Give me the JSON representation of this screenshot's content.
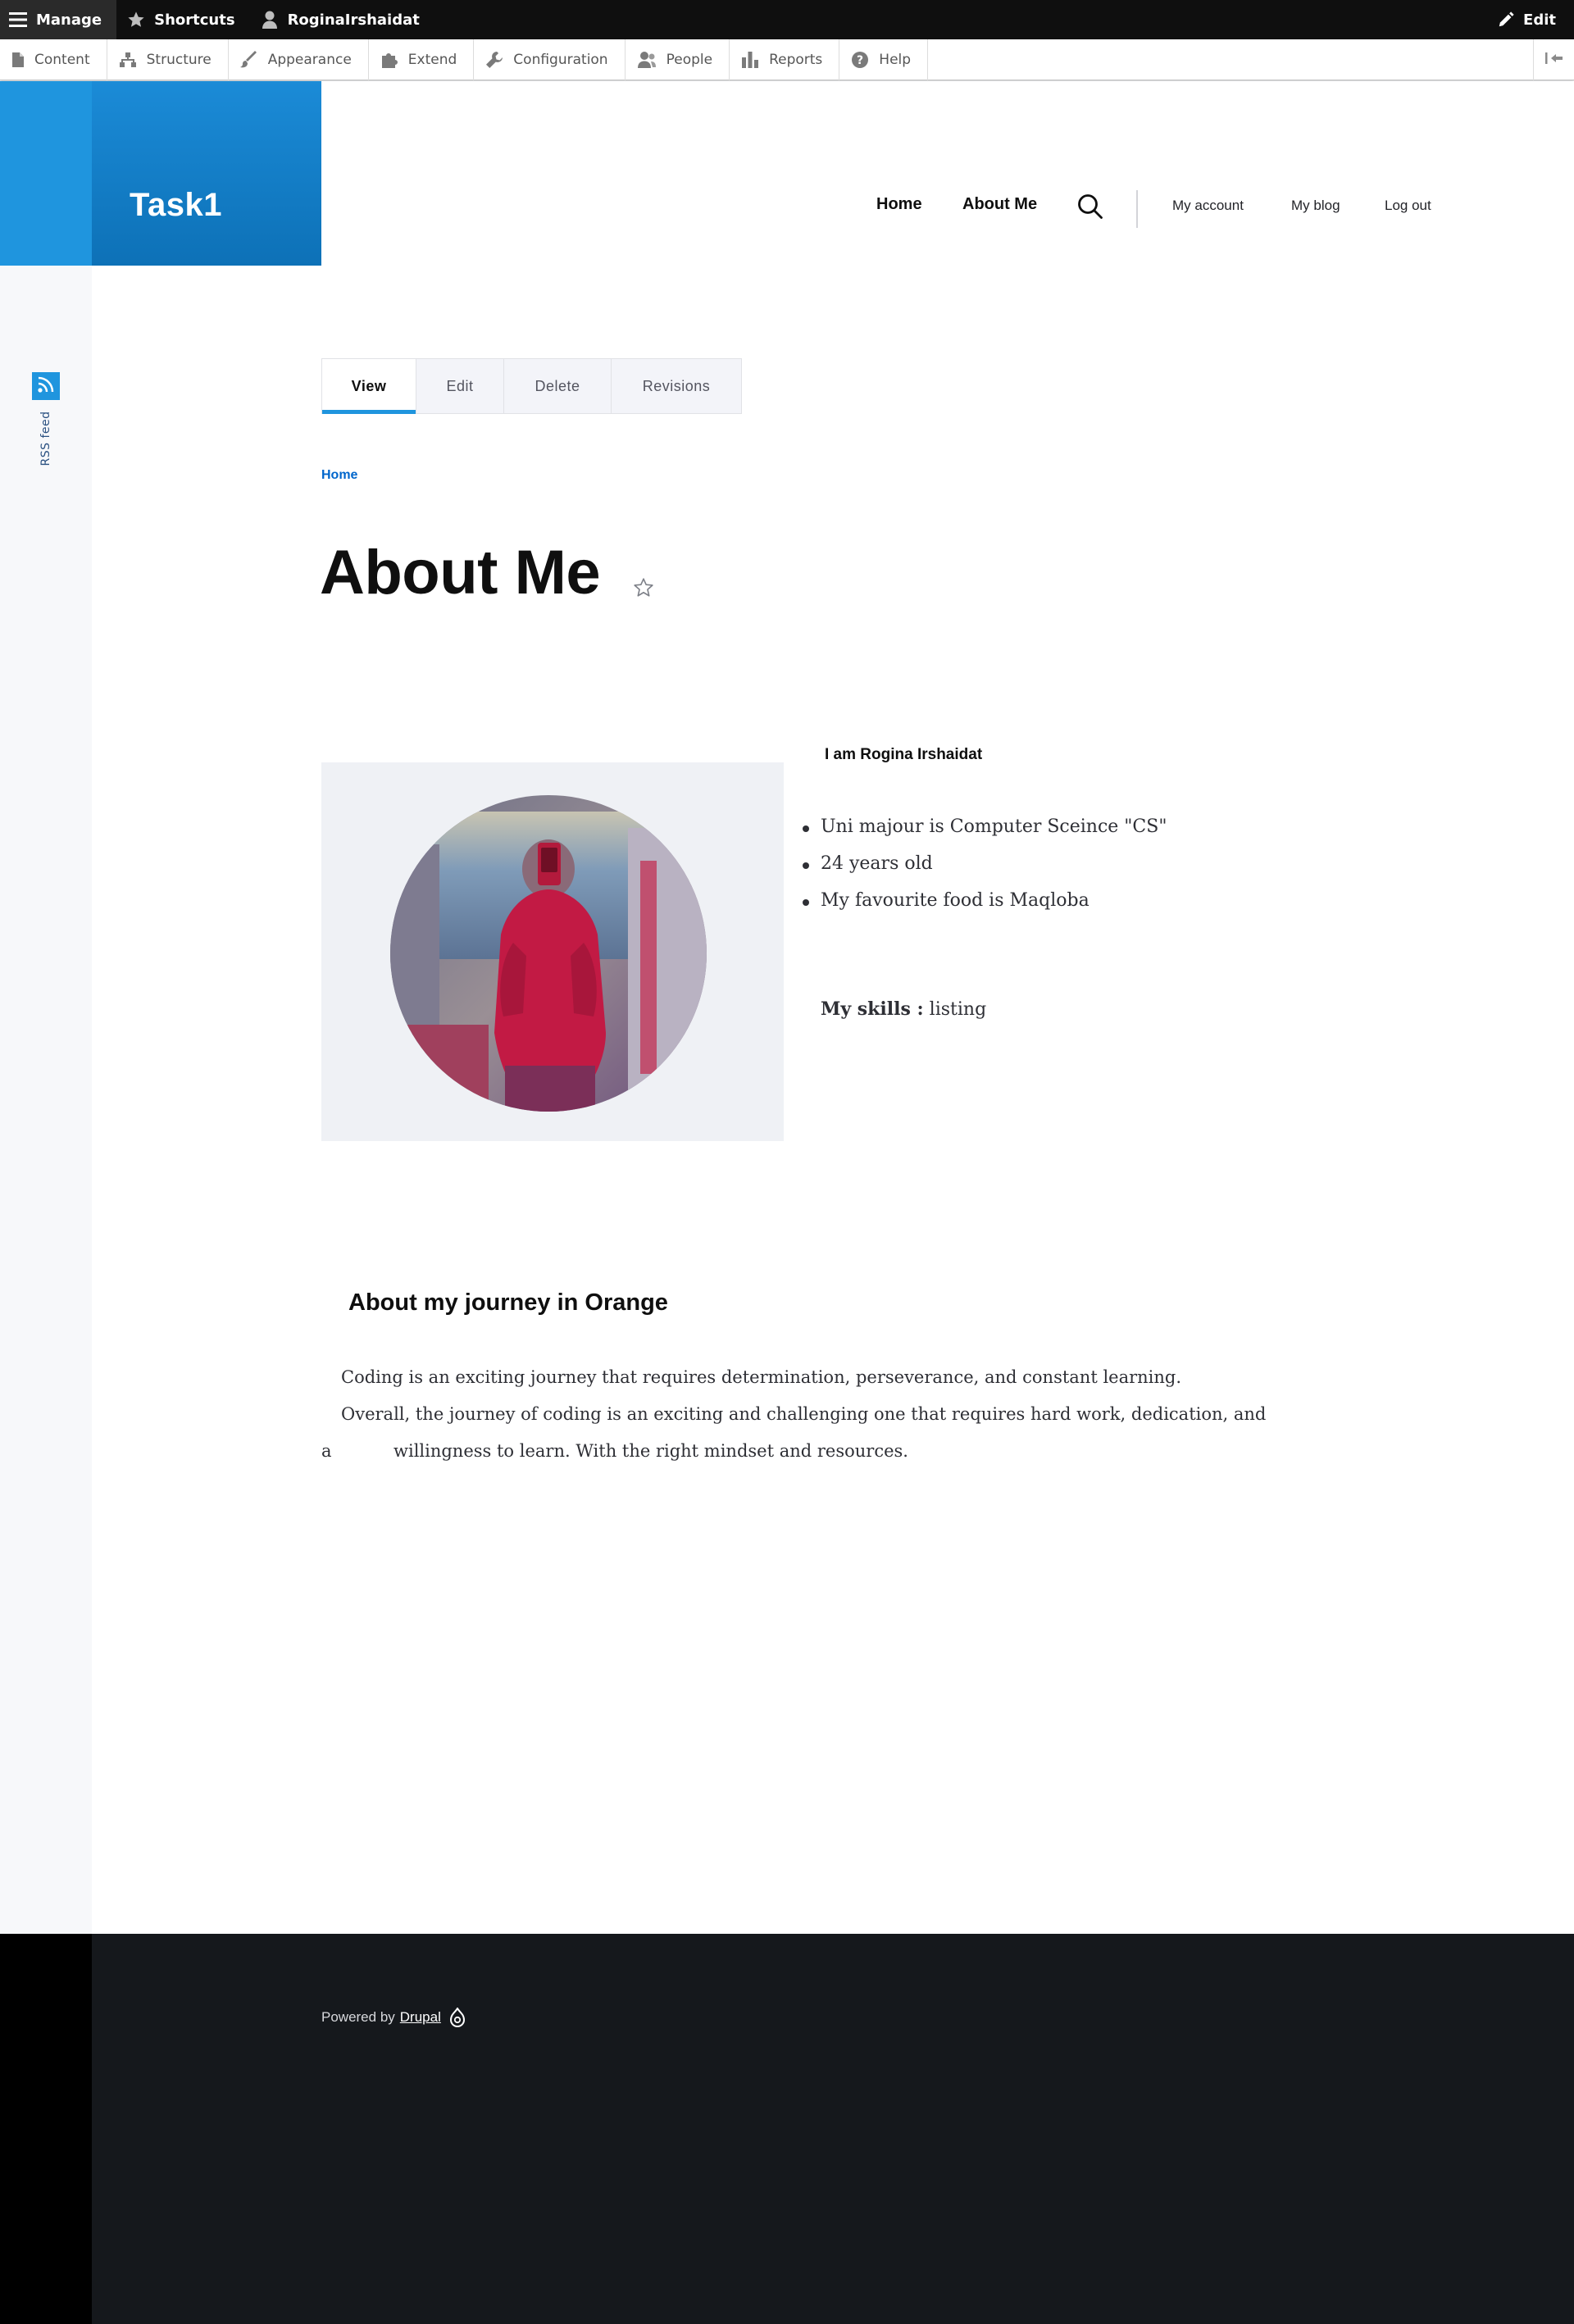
{
  "toolbar": {
    "manage": "Manage",
    "shortcuts": "Shortcuts",
    "user": "RoginaIrshaidat",
    "edit": "Edit"
  },
  "tray": {
    "items": [
      "Content",
      "Structure",
      "Appearance",
      "Extend",
      "Configuration",
      "People",
      "Reports",
      "Help"
    ]
  },
  "site": {
    "name": "Task1"
  },
  "nav": {
    "primary": [
      "Home",
      "About Me"
    ],
    "secondary": [
      "My account",
      "My blog",
      "Log out"
    ]
  },
  "rss": {
    "label": "RSS feed"
  },
  "tabs": [
    "View",
    "Edit",
    "Delete",
    "Revisions"
  ],
  "breadcrumb": {
    "home": "Home"
  },
  "page": {
    "title": "About Me"
  },
  "about": {
    "intro": "I am Rogina Irshaidat",
    "facts": [
      "Uni majour is Computer Sceince \"CS\"",
      "24 years old",
      "My favourite food is Maqloba"
    ],
    "skills_label": "My skills :",
    "skills_value": " listing"
  },
  "journey": {
    "title": "About my journey in Orange",
    "line1": "Coding is an exciting journey that requires determination, perseverance, and constant learning.",
    "line2": "Overall, the journey of coding is an exciting and challenging one that requires hard work, dedication, and",
    "line3_a": "a",
    "line3_b": "willingness to learn. With the right mindset and resources."
  },
  "footer": {
    "powered": "Powered by",
    "drupal": "Drupal"
  },
  "colors": {
    "accent": "#1f95de",
    "toolbar_bg": "#0f0f0f",
    "footer_bg": "#15181c"
  }
}
